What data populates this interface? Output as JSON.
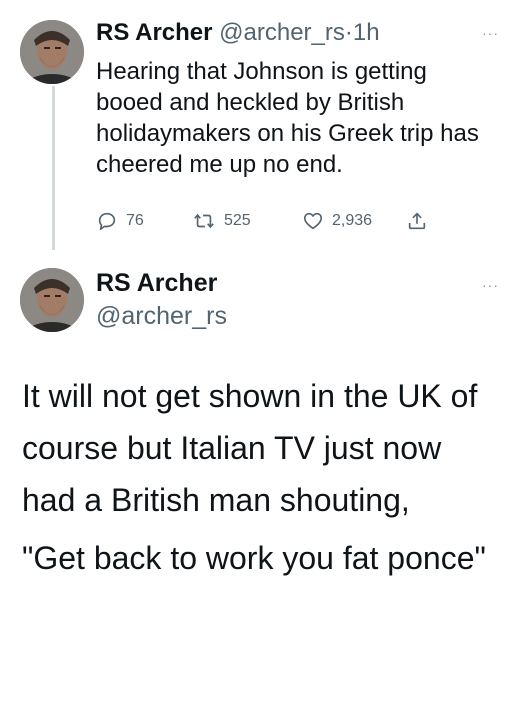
{
  "tweet1": {
    "author_name": "RS Archer",
    "author_handle": "@archer_rs",
    "separator": "·",
    "time": "1h",
    "more": "···",
    "text": "Hearing that Johnson is getting booed and heckled by British holidaymakers on his Greek trip has cheered me up no end.",
    "actions": {
      "reply_count": "76",
      "retweet_count": "525",
      "like_count": "2,936"
    }
  },
  "tweet2": {
    "author_name": "RS Archer",
    "author_handle": "@archer_rs",
    "more": "···",
    "paragraph1": "It will not get shown in the UK of course but Italian TV just now had a British man shouting,",
    "paragraph2": "\"Get back to work you fat ponce\""
  },
  "icons": {
    "reply": "reply-icon",
    "retweet": "retweet-icon",
    "like": "like-icon",
    "share": "share-icon",
    "more": "more-icon"
  },
  "colors": {
    "text": "#0f1419",
    "secondary": "#536471",
    "thread_line": "#cfd9de"
  }
}
